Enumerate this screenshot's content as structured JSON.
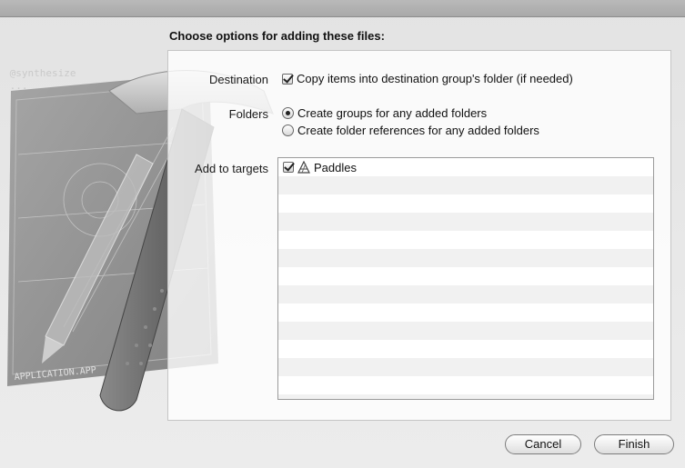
{
  "sheet": {
    "title": "Choose options for adding these files:"
  },
  "destination": {
    "label": "Destination",
    "copy_option": "Copy items into destination group's folder (if needed)",
    "copy_checked": true
  },
  "folders": {
    "label": "Folders",
    "options": [
      {
        "label": "Create groups for any added folders",
        "selected": true
      },
      {
        "label": "Create folder references for any added folders",
        "selected": false
      }
    ]
  },
  "targets": {
    "label": "Add to targets",
    "items": [
      {
        "name": "Paddles",
        "checked": true,
        "icon": "app-target-icon"
      }
    ]
  },
  "buttons": {
    "cancel": "Cancel",
    "finish": "Finish"
  },
  "background": {
    "art_label": "APPLICATION.APP"
  }
}
